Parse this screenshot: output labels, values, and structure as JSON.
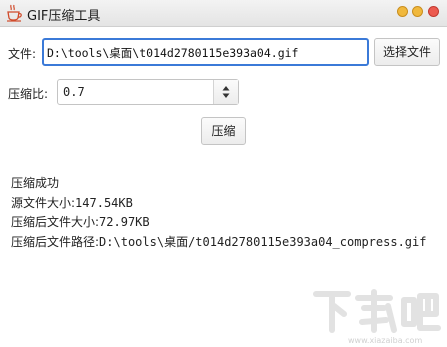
{
  "window": {
    "title": "GIF压缩工具",
    "app_icon": "coffee-cup-icon",
    "controls": [
      "minimize-icon",
      "maximize-icon",
      "close-icon"
    ],
    "colors": {
      "control_yellow": "#f0b83c",
      "control_red": "#ec5a4f",
      "focus_border": "#3b7ad8"
    }
  },
  "file": {
    "label": "文件:",
    "value": "D:\\tools\\桌面\\t014d2780115e393a04.gif",
    "choose_button": "选择文件"
  },
  "ratio": {
    "label": "压缩比:",
    "value": "0.7",
    "spinner_icon": "up-down-arrows-icon"
  },
  "compress_button": "压缩",
  "result": {
    "status": "压缩成功",
    "source_size_label": "源文件大小:",
    "source_size": "147.54KB",
    "compressed_size_label": "压缩后文件大小:",
    "compressed_size": "72.97KB",
    "compressed_path_label": "压缩后文件路径:",
    "compressed_path": "D:\\tools\\桌面/t014d2780115e393a04_compress.gif"
  },
  "watermark": {
    "logo_text": "下载吧",
    "url": "www.xiazaiba.com"
  }
}
